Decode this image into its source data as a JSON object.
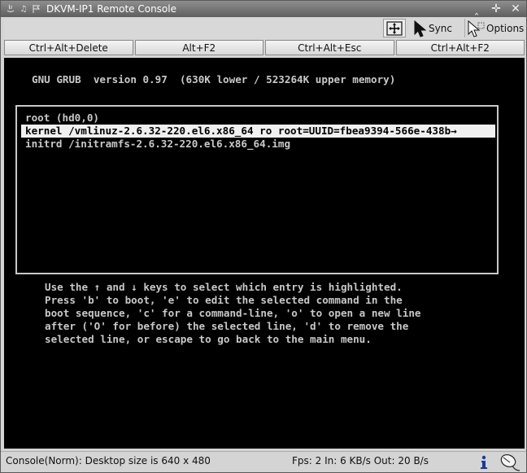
{
  "window": {
    "title": "DKVM-IP1 Remote Console"
  },
  "toolbar": {
    "fit_icon": "move-arrows-icon",
    "sync_label": "Sync",
    "options_label": "Options"
  },
  "keys": [
    {
      "label": "Ctrl+Alt+Delete"
    },
    {
      "label": "Alt+F2"
    },
    {
      "label": "Ctrl+Alt+Esc"
    },
    {
      "label": "Ctrl+Alt+F2"
    }
  ],
  "console": {
    "header": "GNU GRUB  version 0.97  (630K lower / 523264K upper memory)",
    "entries": [
      {
        "text": "root (hd0,0)"
      },
      {
        "text": "kernel /vmlinuz-2.6.32-220.el6.x86_64 ro root=UUID=fbea9394-566e-438b→"
      },
      {
        "text": "initrd /initramfs-2.6.32-220.el6.x86_64.img"
      }
    ],
    "help": [
      "Use the ↑ and ↓ keys to select which entry is highlighted.",
      "Press 'b' to boot, 'e' to edit the selected command in the",
      "boot sequence, 'c' for a command-line, 'o' to open a new line",
      "after ('O' for before) the selected line, 'd' to remove the",
      "selected line, or escape to go back to the main menu."
    ]
  },
  "status": {
    "left": "Console(Norm): Desktop size is 640 x 480",
    "right": "Fps: 2 In: 6 KB/s Out: 20 B/s"
  },
  "colors": {
    "console_bg": "#000000",
    "console_fg": "#c8c8c8",
    "selection_bg": "#f0f0f0"
  }
}
